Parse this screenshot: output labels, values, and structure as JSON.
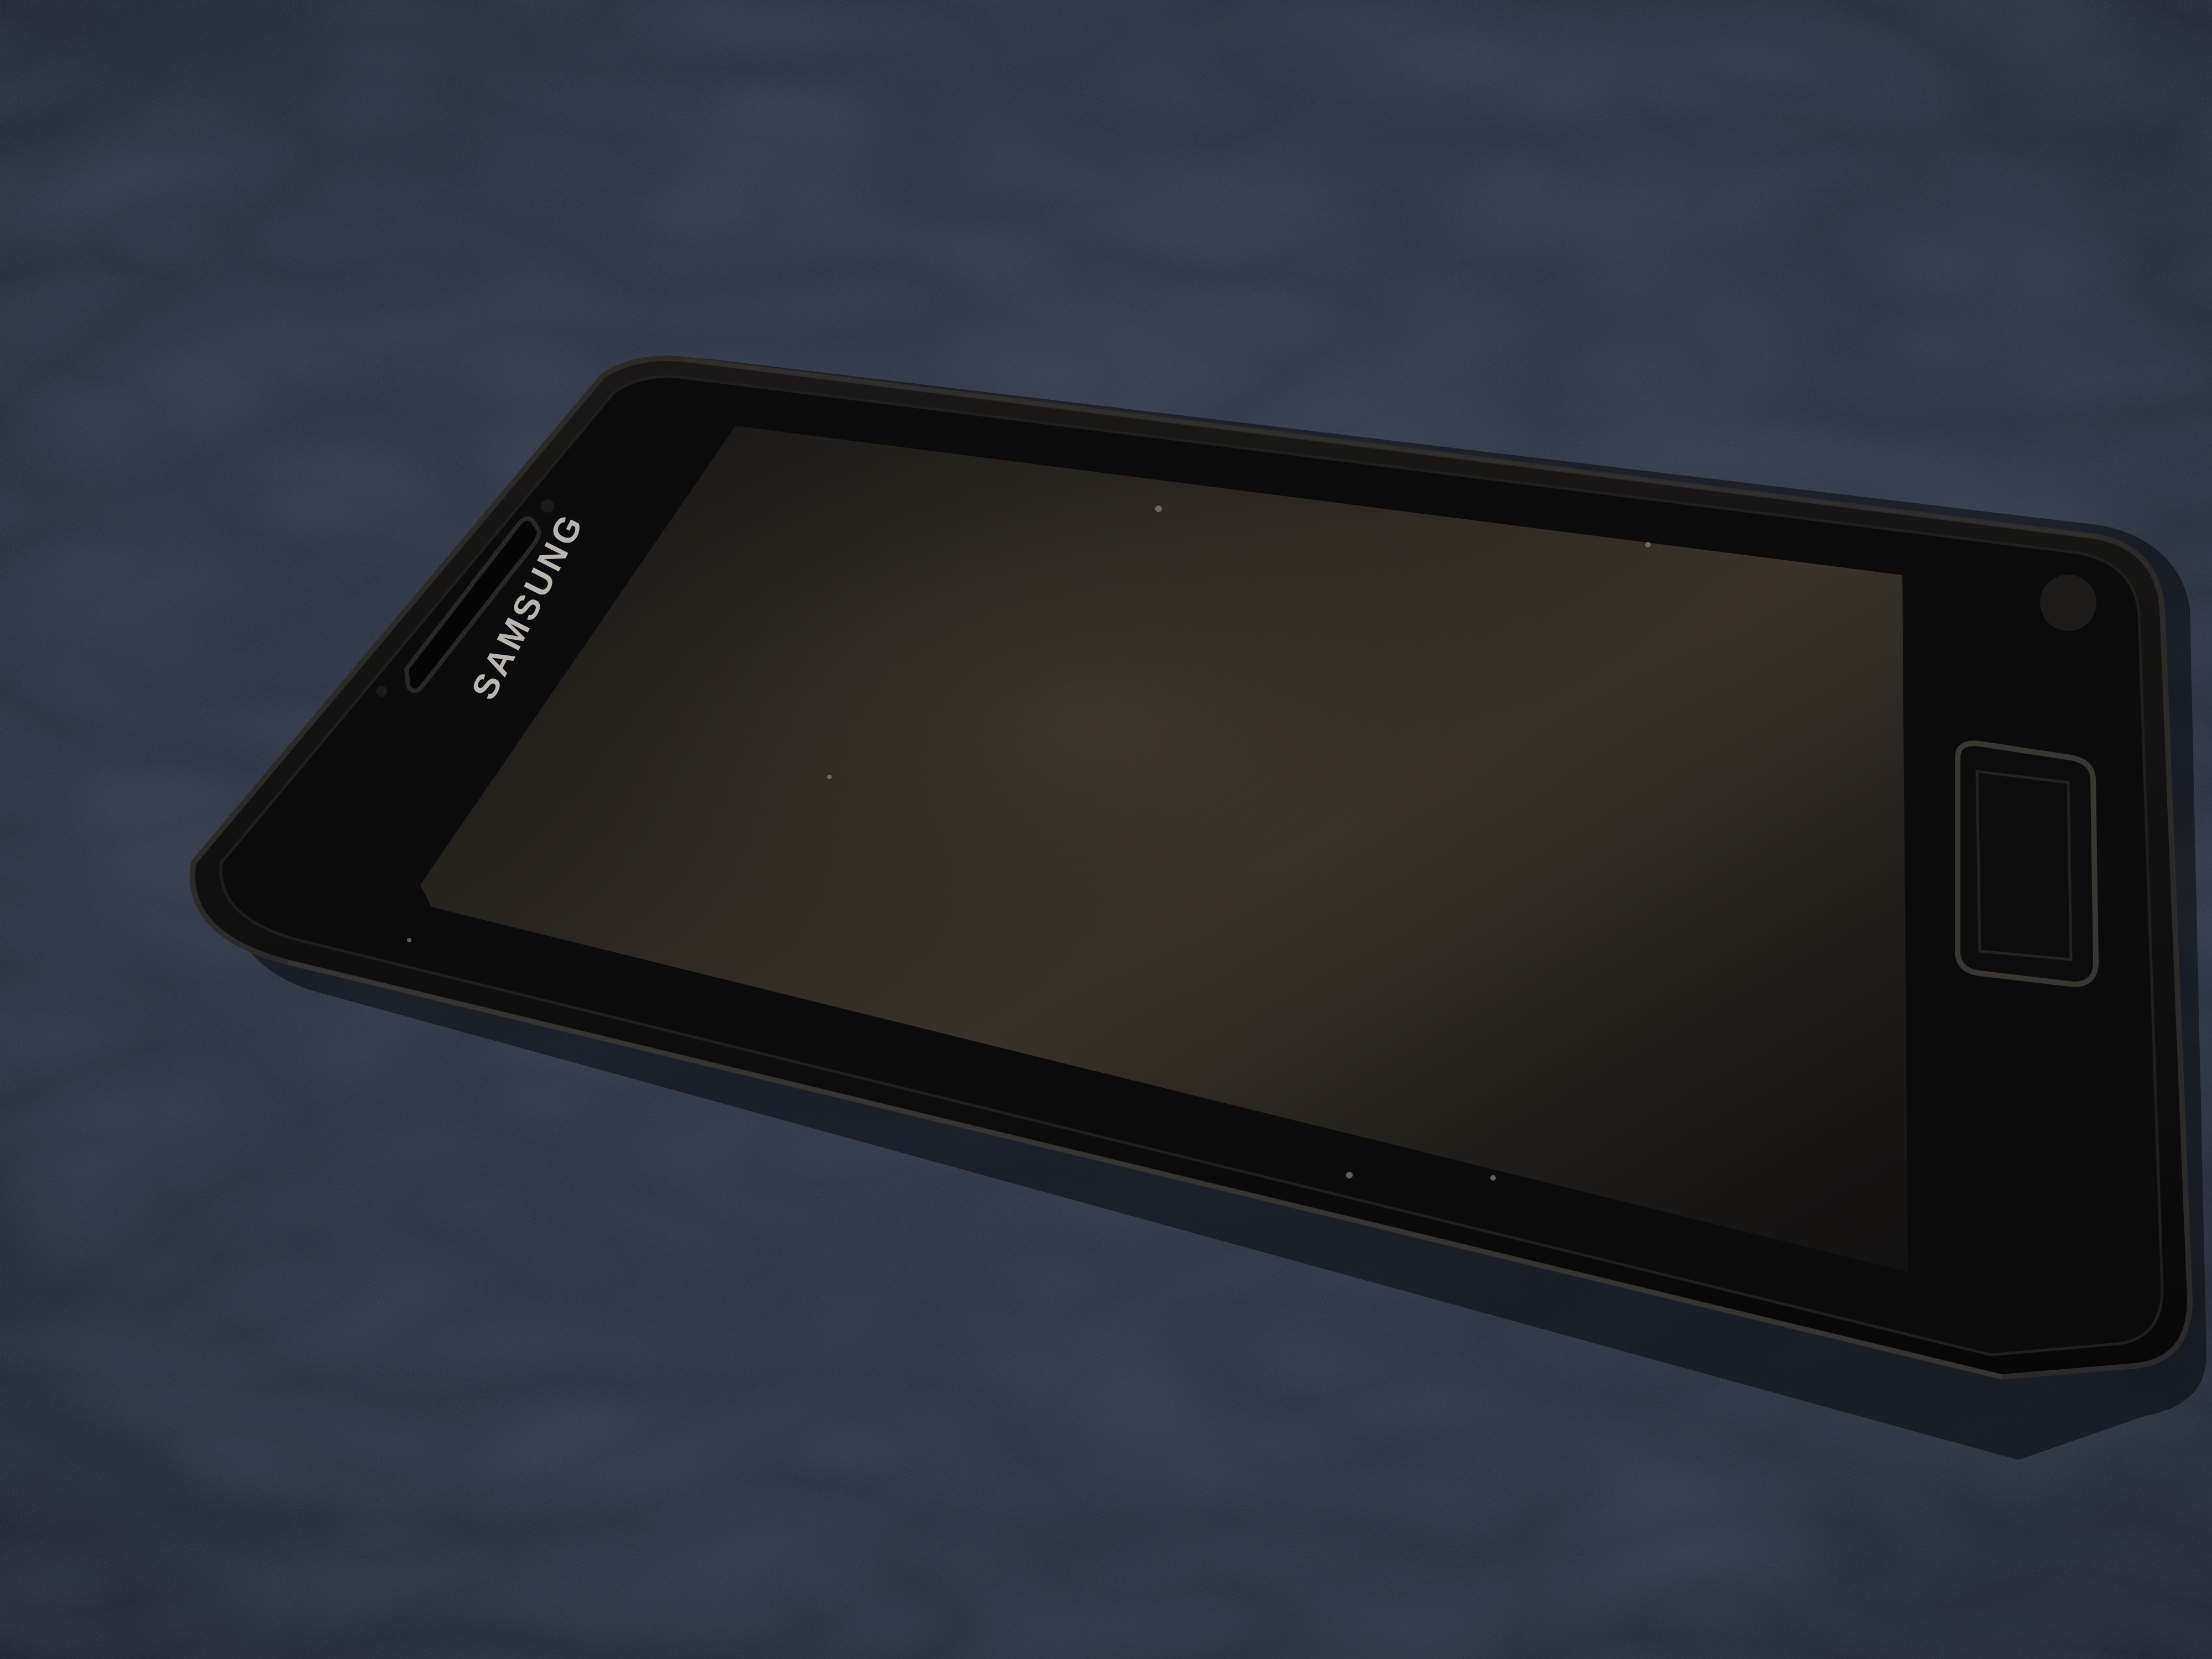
{
  "photo": {
    "brand_label": "SAMSUNG",
    "colors": {
      "fabric": "#232b3b",
      "fabric_dark": "#121722",
      "fabric_light": "#3a4457",
      "phone_body": "#0d0d0f",
      "screen": "#1d1a17",
      "screen_highlight": "#3a342b",
      "bezel_edge": "#2a2826"
    }
  }
}
